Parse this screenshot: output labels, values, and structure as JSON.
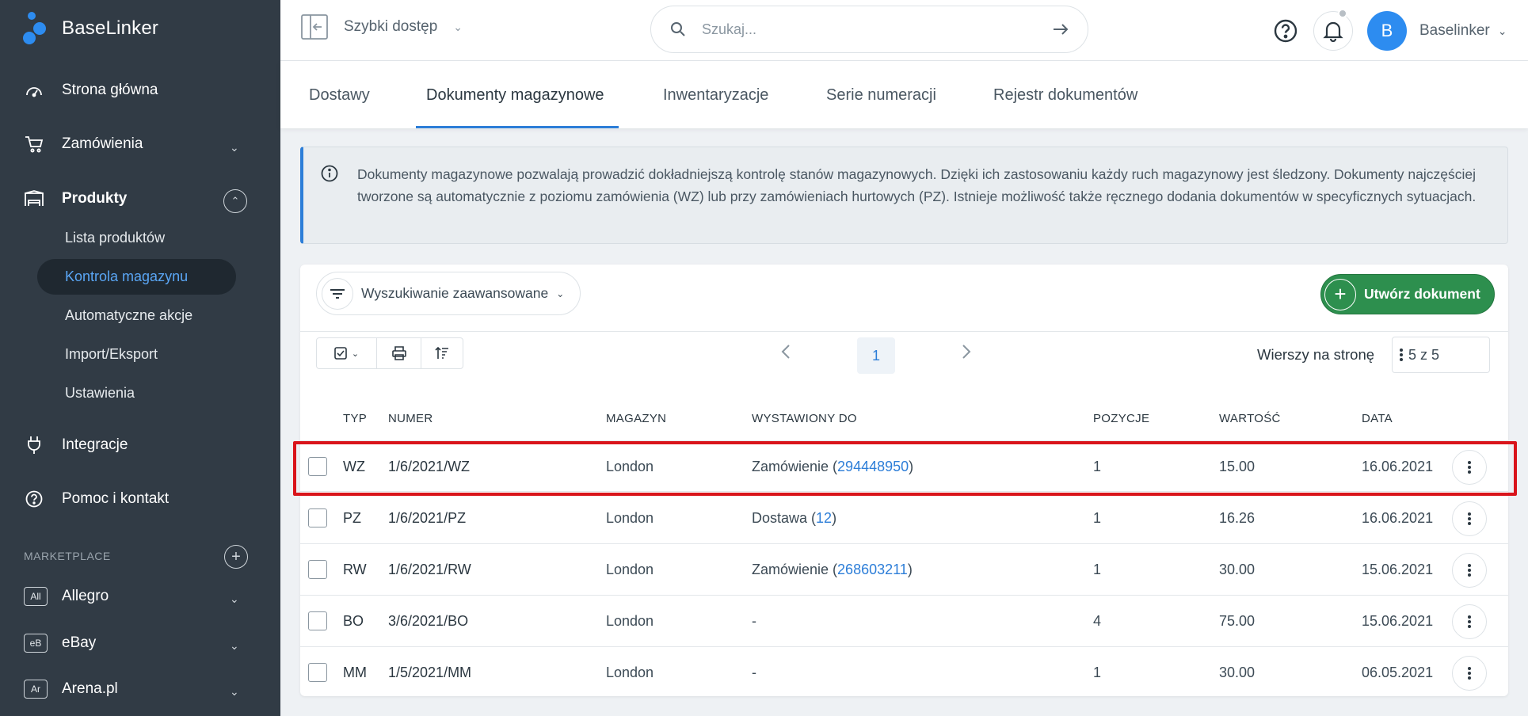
{
  "app": {
    "name": "BaseLinker"
  },
  "sidebar": {
    "items": [
      {
        "label": "Strona główna",
        "icon": "gauge-icon"
      },
      {
        "label": "Zamówienia",
        "icon": "cart-icon"
      },
      {
        "label": "Produkty",
        "icon": "warehouse-icon"
      },
      {
        "label": "Integracje",
        "icon": "plug-icon"
      },
      {
        "label": "Pomoc i kontakt",
        "icon": "help-icon"
      }
    ],
    "sub_items": [
      "Lista produktów",
      "Kontrola magazynu",
      "Automatyczne akcje",
      "Import/Eksport",
      "Ustawienia"
    ],
    "active_sub": "Kontrola magazynu",
    "marketplace_label": "MARKETPLACE",
    "marketplaces": [
      {
        "badge": "All",
        "label": "Allegro"
      },
      {
        "badge": "eB",
        "label": "eBay"
      },
      {
        "badge": "Ar",
        "label": "Arena.pl"
      }
    ]
  },
  "topbar": {
    "quick_access": "Szybki dostęp",
    "search_placeholder": "Szukaj...",
    "user": {
      "initial": "B",
      "name": "Baselinker"
    }
  },
  "tabs": [
    "Dostawy",
    "Dokumenty magazynowe",
    "Inwentaryzacje",
    "Serie numeracji",
    "Rejestr dokumentów"
  ],
  "active_tab": "Dokumenty magazynowe",
  "info_text": "Dokumenty magazynowe pozwalają prowadzić dokładniejszą kontrolę stanów magazynowych. Dzięki ich zastosowaniu każdy ruch magazynowy jest śledzony. Dokumenty najczęściej tworzone są automatycznie z poziomu zamówienia (WZ) lub przy zamówieniach hurtowych (PZ). Istnieje możliwość także ręcznego dodania dokumentów w specyficznych sytuacjach.",
  "toolbar": {
    "advanced_search": "Wyszukiwanie zaawansowane",
    "create_button": "Utwórz dokument",
    "page": "1",
    "rows_per_page_label": "Wierszy na stronę",
    "rows_per_page_value": "5 z 5"
  },
  "table": {
    "headers": {
      "typ": "TYP",
      "numer": "NUMER",
      "magazyn": "MAGAZYN",
      "wystawiony": "WYSTAWIONY DO",
      "pozycje": "POZYCJE",
      "wartosc": "WARTOŚĆ",
      "data": "DATA"
    },
    "rows": [
      {
        "typ": "WZ",
        "numer": "1/6/2021/WZ",
        "magazyn": "London",
        "w_prefix": "Zamówienie (",
        "w_link": "294448950",
        "w_suffix": ")",
        "pozycje": "1",
        "wartosc": "15.00",
        "data": "16.06.2021"
      },
      {
        "typ": "PZ",
        "numer": "1/6/2021/PZ",
        "magazyn": "London",
        "w_prefix": "Dostawa (",
        "w_link": "12",
        "w_suffix": ")",
        "pozycje": "1",
        "wartosc": "16.26",
        "data": "16.06.2021"
      },
      {
        "typ": "RW",
        "numer": "1/6/2021/RW",
        "magazyn": "London",
        "w_prefix": "Zamówienie (",
        "w_link": "268603211",
        "w_suffix": ")",
        "pozycje": "1",
        "wartosc": "30.00",
        "data": "15.06.2021"
      },
      {
        "typ": "BO",
        "numer": "3/6/2021/BO",
        "magazyn": "London",
        "w_prefix": "-",
        "w_link": "",
        "w_suffix": "",
        "pozycje": "4",
        "wartosc": "75.00",
        "data": "15.06.2021"
      },
      {
        "typ": "MM",
        "numer": "1/5/2021/MM",
        "magazyn": "London",
        "w_prefix": "-",
        "w_link": "",
        "w_suffix": "",
        "pozycje": "1",
        "wartosc": "30.00",
        "data": "06.05.2021"
      }
    ]
  },
  "colors": {
    "accent": "#2d7ed8",
    "sidebar": "#313b45",
    "create": "#2d8f4e",
    "highlight": "#d9141b"
  }
}
